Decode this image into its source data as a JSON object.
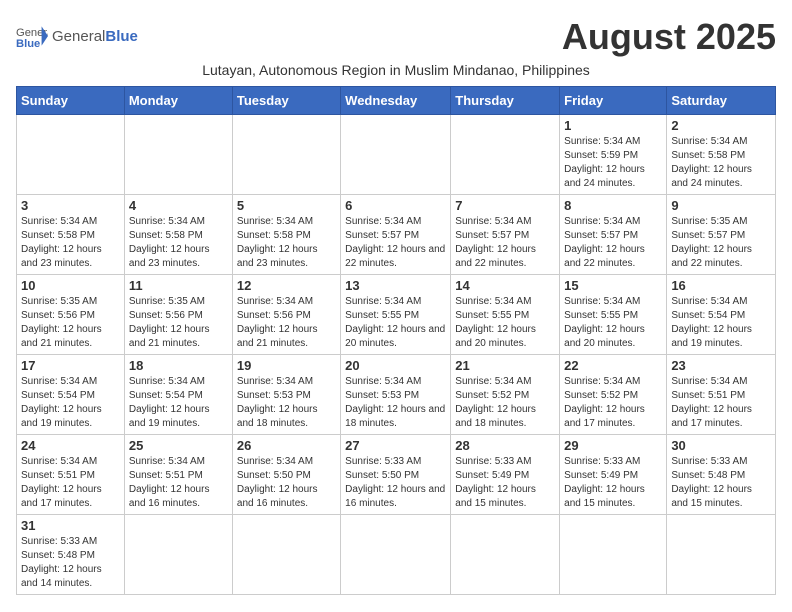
{
  "header": {
    "logo_general": "General",
    "logo_blue": "Blue",
    "month_title": "August 2025",
    "subtitle": "Lutayan, Autonomous Region in Muslim Mindanao, Philippines"
  },
  "weekdays": [
    "Sunday",
    "Monday",
    "Tuesday",
    "Wednesday",
    "Thursday",
    "Friday",
    "Saturday"
  ],
  "weeks": [
    [
      {
        "day": "",
        "info": ""
      },
      {
        "day": "",
        "info": ""
      },
      {
        "day": "",
        "info": ""
      },
      {
        "day": "",
        "info": ""
      },
      {
        "day": "",
        "info": ""
      },
      {
        "day": "1",
        "info": "Sunrise: 5:34 AM\nSunset: 5:59 PM\nDaylight: 12 hours and 24 minutes."
      },
      {
        "day": "2",
        "info": "Sunrise: 5:34 AM\nSunset: 5:58 PM\nDaylight: 12 hours and 24 minutes."
      }
    ],
    [
      {
        "day": "3",
        "info": "Sunrise: 5:34 AM\nSunset: 5:58 PM\nDaylight: 12 hours and 23 minutes."
      },
      {
        "day": "4",
        "info": "Sunrise: 5:34 AM\nSunset: 5:58 PM\nDaylight: 12 hours and 23 minutes."
      },
      {
        "day": "5",
        "info": "Sunrise: 5:34 AM\nSunset: 5:58 PM\nDaylight: 12 hours and 23 minutes."
      },
      {
        "day": "6",
        "info": "Sunrise: 5:34 AM\nSunset: 5:57 PM\nDaylight: 12 hours and 22 minutes."
      },
      {
        "day": "7",
        "info": "Sunrise: 5:34 AM\nSunset: 5:57 PM\nDaylight: 12 hours and 22 minutes."
      },
      {
        "day": "8",
        "info": "Sunrise: 5:34 AM\nSunset: 5:57 PM\nDaylight: 12 hours and 22 minutes."
      },
      {
        "day": "9",
        "info": "Sunrise: 5:35 AM\nSunset: 5:57 PM\nDaylight: 12 hours and 22 minutes."
      }
    ],
    [
      {
        "day": "10",
        "info": "Sunrise: 5:35 AM\nSunset: 5:56 PM\nDaylight: 12 hours and 21 minutes."
      },
      {
        "day": "11",
        "info": "Sunrise: 5:35 AM\nSunset: 5:56 PM\nDaylight: 12 hours and 21 minutes."
      },
      {
        "day": "12",
        "info": "Sunrise: 5:34 AM\nSunset: 5:56 PM\nDaylight: 12 hours and 21 minutes."
      },
      {
        "day": "13",
        "info": "Sunrise: 5:34 AM\nSunset: 5:55 PM\nDaylight: 12 hours and 20 minutes."
      },
      {
        "day": "14",
        "info": "Sunrise: 5:34 AM\nSunset: 5:55 PM\nDaylight: 12 hours and 20 minutes."
      },
      {
        "day": "15",
        "info": "Sunrise: 5:34 AM\nSunset: 5:55 PM\nDaylight: 12 hours and 20 minutes."
      },
      {
        "day": "16",
        "info": "Sunrise: 5:34 AM\nSunset: 5:54 PM\nDaylight: 12 hours and 19 minutes."
      }
    ],
    [
      {
        "day": "17",
        "info": "Sunrise: 5:34 AM\nSunset: 5:54 PM\nDaylight: 12 hours and 19 minutes."
      },
      {
        "day": "18",
        "info": "Sunrise: 5:34 AM\nSunset: 5:54 PM\nDaylight: 12 hours and 19 minutes."
      },
      {
        "day": "19",
        "info": "Sunrise: 5:34 AM\nSunset: 5:53 PM\nDaylight: 12 hours and 18 minutes."
      },
      {
        "day": "20",
        "info": "Sunrise: 5:34 AM\nSunset: 5:53 PM\nDaylight: 12 hours and 18 minutes."
      },
      {
        "day": "21",
        "info": "Sunrise: 5:34 AM\nSunset: 5:52 PM\nDaylight: 12 hours and 18 minutes."
      },
      {
        "day": "22",
        "info": "Sunrise: 5:34 AM\nSunset: 5:52 PM\nDaylight: 12 hours and 17 minutes."
      },
      {
        "day": "23",
        "info": "Sunrise: 5:34 AM\nSunset: 5:51 PM\nDaylight: 12 hours and 17 minutes."
      }
    ],
    [
      {
        "day": "24",
        "info": "Sunrise: 5:34 AM\nSunset: 5:51 PM\nDaylight: 12 hours and 17 minutes."
      },
      {
        "day": "25",
        "info": "Sunrise: 5:34 AM\nSunset: 5:51 PM\nDaylight: 12 hours and 16 minutes."
      },
      {
        "day": "26",
        "info": "Sunrise: 5:34 AM\nSunset: 5:50 PM\nDaylight: 12 hours and 16 minutes."
      },
      {
        "day": "27",
        "info": "Sunrise: 5:33 AM\nSunset: 5:50 PM\nDaylight: 12 hours and 16 minutes."
      },
      {
        "day": "28",
        "info": "Sunrise: 5:33 AM\nSunset: 5:49 PM\nDaylight: 12 hours and 15 minutes."
      },
      {
        "day": "29",
        "info": "Sunrise: 5:33 AM\nSunset: 5:49 PM\nDaylight: 12 hours and 15 minutes."
      },
      {
        "day": "30",
        "info": "Sunrise: 5:33 AM\nSunset: 5:48 PM\nDaylight: 12 hours and 15 minutes."
      }
    ],
    [
      {
        "day": "31",
        "info": "Sunrise: 5:33 AM\nSunset: 5:48 PM\nDaylight: 12 hours and 14 minutes."
      },
      {
        "day": "",
        "info": ""
      },
      {
        "day": "",
        "info": ""
      },
      {
        "day": "",
        "info": ""
      },
      {
        "day": "",
        "info": ""
      },
      {
        "day": "",
        "info": ""
      },
      {
        "day": "",
        "info": ""
      }
    ]
  ]
}
